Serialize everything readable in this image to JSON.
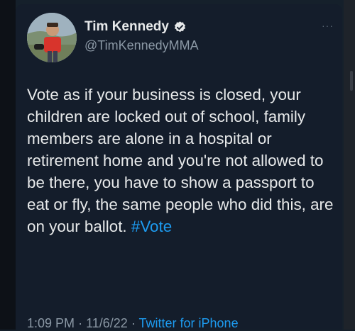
{
  "tweet": {
    "author_name": "Tim Kennedy",
    "handle": "@TimKennedyMMA",
    "more_label": "···",
    "text": "Vote as if your business is closed, your children are locked out of school, family members are alone in a hospital or retirement home and you're not allowed to be there, you have to show a passport to eat or fly, the same people who did this, are on your ballot.",
    "hashtag": "#Vote",
    "time": "1:09 PM",
    "separator": "·",
    "date": "11/6/22",
    "source": "Twitter for iPhone"
  },
  "icons": {
    "verified": "verified-badge-icon",
    "more": "more-options-icon",
    "avatar": "profile-photo"
  },
  "colors": {
    "background": "#15202b",
    "text_primary": "#e7e9ea",
    "text_secondary": "#8b98a5",
    "accent": "#1d9bf0"
  }
}
